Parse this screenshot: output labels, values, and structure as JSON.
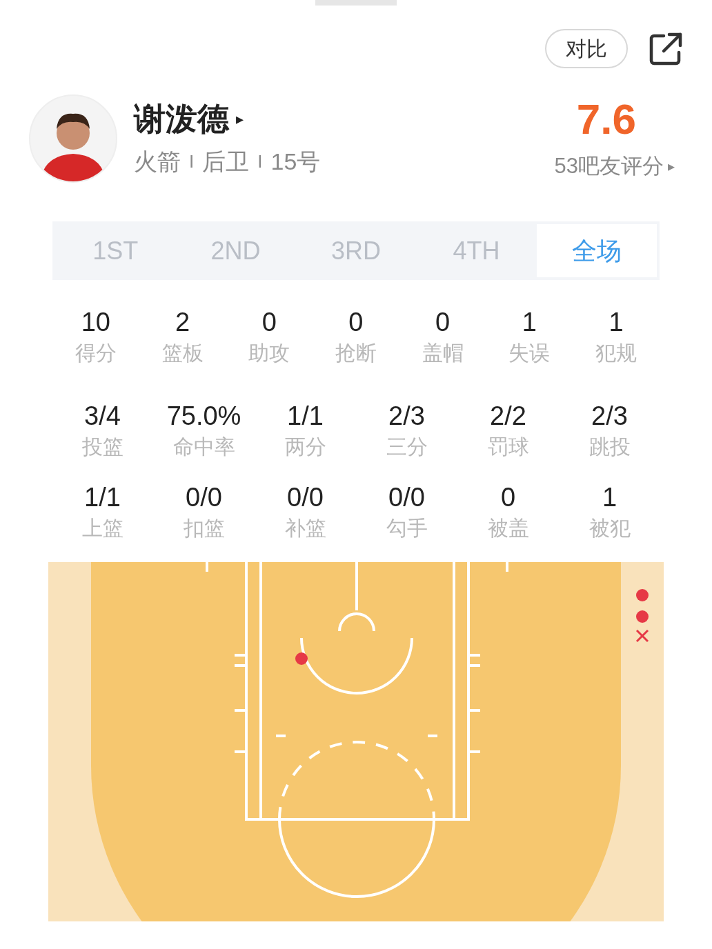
{
  "header": {
    "compare_button": "对比"
  },
  "player": {
    "name": "谢泼德",
    "name_arrow": "▸",
    "team": "火箭",
    "sep1": "I",
    "position": "后卫",
    "sep2": "I",
    "number": "15号",
    "rating": "7.6",
    "rating_count": "53吧友评分",
    "rating_arrow": "▸"
  },
  "tabs": [
    {
      "label": "1ST",
      "selected": false
    },
    {
      "label": "2ND",
      "selected": false
    },
    {
      "label": "3RD",
      "selected": false
    },
    {
      "label": "4TH",
      "selected": false
    },
    {
      "label": "全场",
      "selected": true
    }
  ],
  "main_stats": [
    {
      "value": "10",
      "label": "得分"
    },
    {
      "value": "2",
      "label": "篮板"
    },
    {
      "value": "0",
      "label": "助攻"
    },
    {
      "value": "0",
      "label": "抢断"
    },
    {
      "value": "0",
      "label": "盖帽"
    },
    {
      "value": "1",
      "label": "失误"
    },
    {
      "value": "1",
      "label": "犯规"
    }
  ],
  "shooting_stats": [
    {
      "value": "3/4",
      "label": "投篮"
    },
    {
      "value": "75.0%",
      "label": "命中率"
    },
    {
      "value": "1/1",
      "label": "两分"
    },
    {
      "value": "2/3",
      "label": "三分"
    },
    {
      "value": "2/2",
      "label": "罚球"
    },
    {
      "value": "2/3",
      "label": "跳投"
    },
    {
      "value": "1/1",
      "label": "上篮"
    },
    {
      "value": "0/0",
      "label": "扣篮"
    },
    {
      "value": "0/0",
      "label": "补篮"
    },
    {
      "value": "0/0",
      "label": "勾手"
    },
    {
      "value": "0",
      "label": "被盖"
    },
    {
      "value": "1",
      "label": "被犯"
    }
  ],
  "shot_chart": {
    "shots": [
      {
        "made": true
      },
      {
        "made": true
      },
      {
        "made": false
      },
      {
        "made": true
      }
    ]
  }
}
